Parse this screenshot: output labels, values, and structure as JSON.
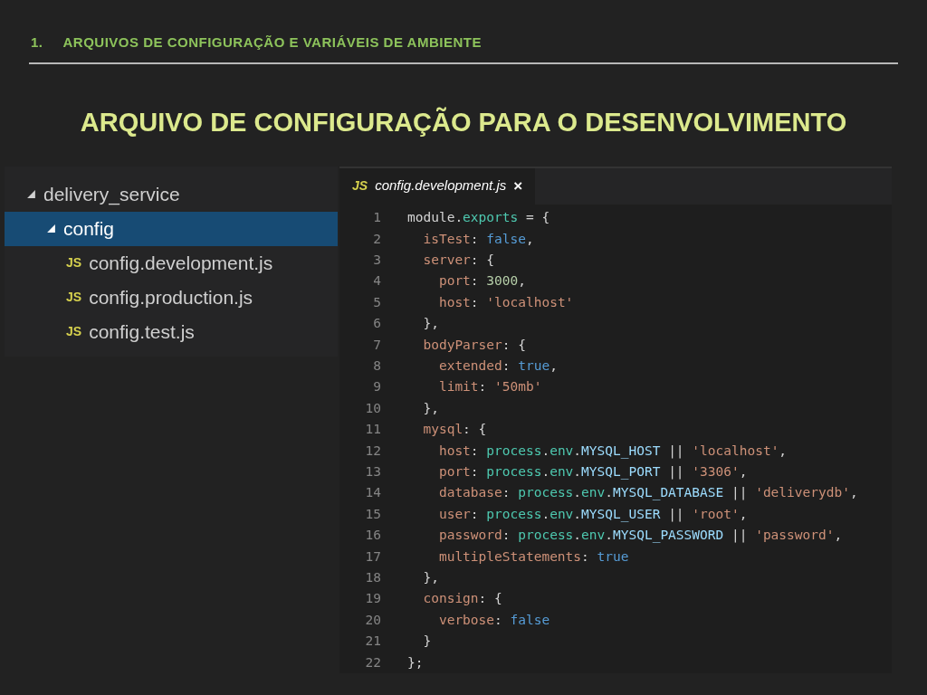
{
  "header": {
    "number": "1.",
    "section": "ARQUIVOS DE CONFIGURAÇÃO E VARIÁVEIS DE AMBIENTE"
  },
  "title": "ARQUIVO DE CONFIGURAÇÃO PARA O DESENVOLVIMENTO",
  "explorer": {
    "items": [
      {
        "label": "delivery_service",
        "kind": "folder",
        "expanded": true,
        "selected": false,
        "children": [
          {
            "label": "config",
            "kind": "folder",
            "expanded": true,
            "selected": true,
            "children": [
              {
                "label": "config.development.js",
                "kind": "js",
                "badge": "JS",
                "selected": false
              },
              {
                "label": "config.production.js",
                "kind": "js",
                "badge": "JS",
                "selected": false
              },
              {
                "label": "config.test.js",
                "kind": "js",
                "badge": "JS",
                "selected": false
              }
            ]
          }
        ]
      }
    ]
  },
  "editor": {
    "tab": {
      "badge": "JS",
      "label": "config.development.js",
      "close": "×",
      "selected": true
    },
    "lines": [
      {
        "number": "1",
        "tokens": [
          {
            "kind": "plain",
            "text": "module."
          },
          {
            "kind": "type",
            "text": "exports"
          },
          {
            "kind": "plain",
            "text": " = {"
          }
        ]
      },
      {
        "number": "2",
        "tokens": [
          {
            "kind": "key",
            "text": "  isTest"
          },
          {
            "kind": "plain",
            "text": ": "
          },
          {
            "kind": "keyword",
            "text": "false"
          },
          {
            "kind": "plain",
            "text": ","
          }
        ]
      },
      {
        "number": "3",
        "tokens": [
          {
            "kind": "key",
            "text": "  server"
          },
          {
            "kind": "plain",
            "text": ": {"
          }
        ]
      },
      {
        "number": "4",
        "tokens": [
          {
            "kind": "key",
            "text": "    port"
          },
          {
            "kind": "plain",
            "text": ": "
          },
          {
            "kind": "number",
            "text": "3000"
          },
          {
            "kind": "plain",
            "text": ","
          }
        ]
      },
      {
        "number": "5",
        "tokens": [
          {
            "kind": "key",
            "text": "    host"
          },
          {
            "kind": "plain",
            "text": ": "
          },
          {
            "kind": "string",
            "text": "'localhost'"
          }
        ]
      },
      {
        "number": "6",
        "tokens": [
          {
            "kind": "plain",
            "text": "  },"
          }
        ]
      },
      {
        "number": "7",
        "tokens": [
          {
            "kind": "key",
            "text": "  bodyParser"
          },
          {
            "kind": "plain",
            "text": ": {"
          }
        ]
      },
      {
        "number": "8",
        "tokens": [
          {
            "kind": "key",
            "text": "    extended"
          },
          {
            "kind": "plain",
            "text": ": "
          },
          {
            "kind": "keyword",
            "text": "true"
          },
          {
            "kind": "plain",
            "text": ","
          }
        ]
      },
      {
        "number": "9",
        "tokens": [
          {
            "kind": "key",
            "text": "    limit"
          },
          {
            "kind": "plain",
            "text": ": "
          },
          {
            "kind": "string",
            "text": "'50mb'"
          }
        ]
      },
      {
        "number": "10",
        "tokens": [
          {
            "kind": "plain",
            "text": "  },"
          }
        ]
      },
      {
        "number": "11",
        "tokens": [
          {
            "kind": "key",
            "text": "  mysql"
          },
          {
            "kind": "plain",
            "text": ": {"
          }
        ]
      },
      {
        "number": "12",
        "tokens": [
          {
            "kind": "key",
            "text": "    host"
          },
          {
            "kind": "plain",
            "text": ": "
          },
          {
            "kind": "type",
            "text": "process"
          },
          {
            "kind": "plain",
            "text": "."
          },
          {
            "kind": "type",
            "text": "env"
          },
          {
            "kind": "plain",
            "text": "."
          },
          {
            "kind": "constant",
            "text": "MYSQL_HOST"
          },
          {
            "kind": "plain",
            "text": " || "
          },
          {
            "kind": "string",
            "text": "'localhost'"
          },
          {
            "kind": "plain",
            "text": ","
          }
        ]
      },
      {
        "number": "13",
        "tokens": [
          {
            "kind": "key",
            "text": "    port"
          },
          {
            "kind": "plain",
            "text": ": "
          },
          {
            "kind": "type",
            "text": "process"
          },
          {
            "kind": "plain",
            "text": "."
          },
          {
            "kind": "type",
            "text": "env"
          },
          {
            "kind": "plain",
            "text": "."
          },
          {
            "kind": "constant",
            "text": "MYSQL_PORT"
          },
          {
            "kind": "plain",
            "text": " || "
          },
          {
            "kind": "string",
            "text": "'3306'"
          },
          {
            "kind": "plain",
            "text": ","
          }
        ]
      },
      {
        "number": "14",
        "tokens": [
          {
            "kind": "key",
            "text": "    database"
          },
          {
            "kind": "plain",
            "text": ": "
          },
          {
            "kind": "type",
            "text": "process"
          },
          {
            "kind": "plain",
            "text": "."
          },
          {
            "kind": "type",
            "text": "env"
          },
          {
            "kind": "plain",
            "text": "."
          },
          {
            "kind": "constant",
            "text": "MYSQL_DATABASE"
          },
          {
            "kind": "plain",
            "text": " || "
          },
          {
            "kind": "string",
            "text": "'deliverydb'"
          },
          {
            "kind": "plain",
            "text": ","
          }
        ]
      },
      {
        "number": "15",
        "tokens": [
          {
            "kind": "key",
            "text": "    user"
          },
          {
            "kind": "plain",
            "text": ": "
          },
          {
            "kind": "type",
            "text": "process"
          },
          {
            "kind": "plain",
            "text": "."
          },
          {
            "kind": "type",
            "text": "env"
          },
          {
            "kind": "plain",
            "text": "."
          },
          {
            "kind": "constant",
            "text": "MYSQL_USER"
          },
          {
            "kind": "plain",
            "text": " || "
          },
          {
            "kind": "string",
            "text": "'root'"
          },
          {
            "kind": "plain",
            "text": ","
          }
        ]
      },
      {
        "number": "16",
        "tokens": [
          {
            "kind": "key",
            "text": "    password"
          },
          {
            "kind": "plain",
            "text": ": "
          },
          {
            "kind": "type",
            "text": "process"
          },
          {
            "kind": "plain",
            "text": "."
          },
          {
            "kind": "type",
            "text": "env"
          },
          {
            "kind": "plain",
            "text": "."
          },
          {
            "kind": "constant",
            "text": "MYSQL_PASSWORD"
          },
          {
            "kind": "plain",
            "text": " || "
          },
          {
            "kind": "string",
            "text": "'password'"
          },
          {
            "kind": "plain",
            "text": ","
          }
        ]
      },
      {
        "number": "17",
        "tokens": [
          {
            "kind": "key",
            "text": "    multipleStatements"
          },
          {
            "kind": "plain",
            "text": ": "
          },
          {
            "kind": "keyword",
            "text": "true"
          }
        ]
      },
      {
        "number": "18",
        "tokens": [
          {
            "kind": "plain",
            "text": "  },"
          }
        ]
      },
      {
        "number": "19",
        "tokens": [
          {
            "kind": "key",
            "text": "  consign"
          },
          {
            "kind": "plain",
            "text": ": {"
          }
        ]
      },
      {
        "number": "20",
        "tokens": [
          {
            "kind": "key",
            "text": "    verbose"
          },
          {
            "kind": "plain",
            "text": ": "
          },
          {
            "kind": "keyword",
            "text": "false"
          }
        ]
      },
      {
        "number": "21",
        "tokens": [
          {
            "kind": "plain",
            "text": "  }"
          }
        ]
      },
      {
        "number": "22",
        "tokens": [
          {
            "kind": "plain",
            "text": "};"
          }
        ]
      }
    ]
  }
}
